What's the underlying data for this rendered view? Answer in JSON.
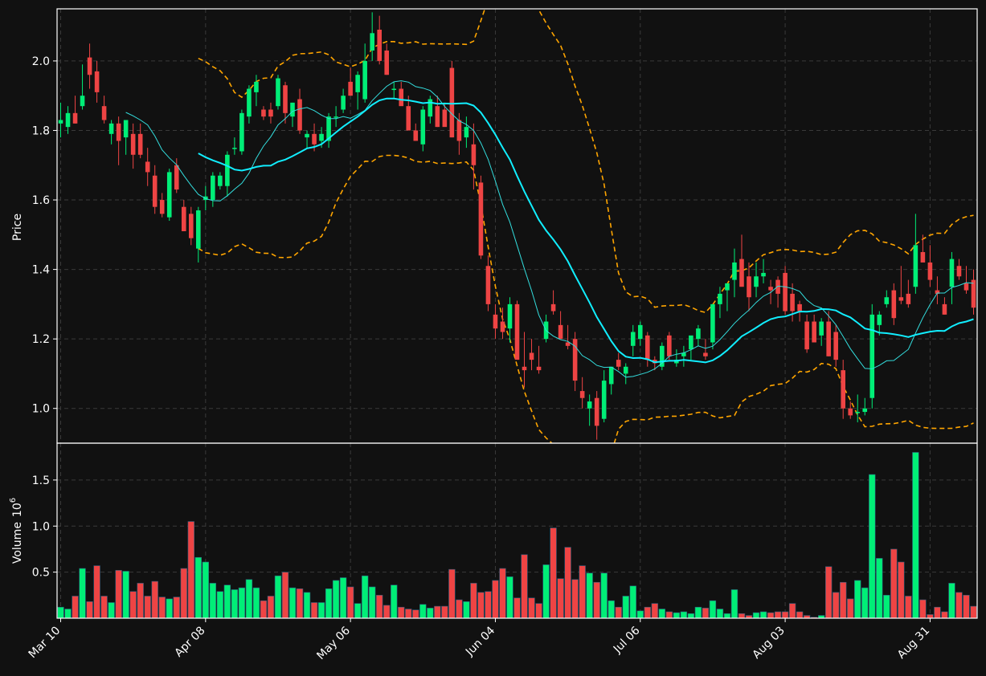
{
  "chart_data": {
    "type": "candlestick",
    "theme": {
      "background": "#111111",
      "up_color": "#00ee77",
      "down_color": "#ee4444",
      "sma_fast_color": "#33dddd",
      "sma_slow_color": "#11eeff",
      "band_color": "#ffa500",
      "grid": true
    },
    "price_axis": {
      "label": "Price",
      "ylim": [
        0.9,
        2.15
      ],
      "ticks": [
        "1.0",
        "1.2",
        "1.4",
        "1.6",
        "1.8",
        "2.0"
      ]
    },
    "volume_axis": {
      "label": "Volume",
      "exponent": "10",
      "exponent_power": "6",
      "ylim": [
        0,
        1.9
      ],
      "ticks": [
        "0.5",
        "1.0",
        "1.5"
      ]
    },
    "x_axis": {
      "ticks": [
        {
          "label": "Mar 10",
          "index": 0
        },
        {
          "label": "Apr 08",
          "index": 20
        },
        {
          "label": "May 06",
          "index": 40
        },
        {
          "label": "Jun 04",
          "index": 60
        },
        {
          "label": "Jul 06",
          "index": 80
        },
        {
          "label": "Aug 03",
          "index": 100
        },
        {
          "label": "Aug 31",
          "index": 120
        }
      ]
    },
    "candles": [
      [
        1.82,
        1.88,
        1.78,
        1.83,
        0.12
      ],
      [
        1.81,
        1.87,
        1.79,
        1.85,
        0.1
      ],
      [
        1.85,
        1.9,
        1.82,
        1.82,
        0.24
      ],
      [
        1.87,
        1.99,
        1.86,
        1.9,
        0.54
      ],
      [
        2.01,
        2.05,
        1.92,
        1.96,
        0.18
      ],
      [
        1.97,
        2.0,
        1.88,
        1.91,
        0.57
      ],
      [
        1.87,
        1.9,
        1.82,
        1.83,
        0.24
      ],
      [
        1.79,
        1.83,
        1.76,
        1.82,
        0.17
      ],
      [
        1.82,
        1.84,
        1.7,
        1.77,
        0.52
      ],
      [
        1.78,
        1.83,
        1.73,
        1.83,
        0.51
      ],
      [
        1.79,
        1.82,
        1.69,
        1.73,
        0.29
      ],
      [
        1.79,
        1.82,
        1.72,
        1.73,
        0.38
      ],
      [
        1.71,
        1.75,
        1.64,
        1.68,
        0.24
      ],
      [
        1.67,
        1.7,
        1.56,
        1.58,
        0.4
      ],
      [
        1.6,
        1.62,
        1.55,
        1.56,
        0.23
      ],
      [
        1.55,
        1.69,
        1.54,
        1.68,
        0.21
      ],
      [
        1.7,
        1.72,
        1.62,
        1.63,
        0.23
      ],
      [
        1.58,
        1.6,
        1.51,
        1.51,
        0.54
      ],
      [
        1.56,
        1.58,
        1.47,
        1.49,
        1.05
      ],
      [
        1.46,
        1.58,
        1.42,
        1.57,
        0.66
      ],
      [
        1.6,
        1.64,
        1.57,
        1.61,
        0.61
      ],
      [
        1.6,
        1.68,
        1.58,
        1.67,
        0.38
      ],
      [
        1.64,
        1.68,
        1.63,
        1.67,
        0.29
      ],
      [
        1.64,
        1.74,
        1.61,
        1.73,
        0.36
      ],
      [
        1.75,
        1.78,
        1.73,
        1.75,
        0.31
      ],
      [
        1.74,
        1.86,
        1.73,
        1.85,
        0.33
      ],
      [
        1.84,
        1.93,
        1.82,
        1.92,
        0.42
      ],
      [
        1.91,
        1.96,
        1.87,
        1.94,
        0.33
      ],
      [
        1.86,
        1.87,
        1.83,
        1.84,
        0.19
      ],
      [
        1.86,
        1.88,
        1.82,
        1.84,
        0.24
      ],
      [
        1.87,
        1.96,
        1.86,
        1.95,
        0.46
      ],
      [
        1.93,
        1.94,
        1.82,
        1.85,
        0.5
      ],
      [
        1.84,
        1.88,
        1.81,
        1.88,
        0.33
      ],
      [
        1.89,
        1.92,
        1.79,
        1.8,
        0.32
      ],
      [
        1.78,
        1.8,
        1.75,
        1.79,
        0.28
      ],
      [
        1.79,
        1.82,
        1.74,
        1.76,
        0.17
      ],
      [
        1.77,
        1.81,
        1.75,
        1.79,
        0.17
      ],
      [
        1.77,
        1.85,
        1.75,
        1.84,
        0.32
      ],
      [
        1.84,
        1.87,
        1.81,
        1.84,
        0.41
      ],
      [
        1.86,
        1.92,
        1.85,
        1.9,
        0.44
      ],
      [
        1.94,
        1.98,
        1.9,
        1.9,
        0.34
      ],
      [
        1.91,
        1.97,
        1.86,
        1.96,
        0.16
      ],
      [
        1.89,
        2.05,
        1.88,
        2.0,
        0.46
      ],
      [
        2.03,
        2.14,
        2.0,
        2.08,
        0.34
      ],
      [
        2.09,
        2.13,
        1.99,
        2.0,
        0.25
      ],
      [
        2.03,
        2.05,
        1.96,
        1.96,
        0.14
      ],
      [
        1.92,
        1.94,
        1.89,
        1.92,
        0.36
      ],
      [
        1.92,
        1.94,
        1.88,
        1.87,
        0.12
      ],
      [
        1.87,
        1.9,
        1.83,
        1.8,
        0.1
      ],
      [
        1.8,
        1.82,
        1.77,
        1.77,
        0.09
      ],
      [
        1.76,
        1.87,
        1.74,
        1.86,
        0.15
      ],
      [
        1.84,
        1.9,
        1.82,
        1.89,
        0.11
      ],
      [
        1.87,
        1.9,
        1.81,
        1.81,
        0.13
      ],
      [
        1.86,
        1.88,
        1.84,
        1.81,
        0.13
      ],
      [
        1.98,
        2.0,
        1.78,
        1.78,
        0.53
      ],
      [
        1.83,
        1.85,
        1.73,
        1.77,
        0.2
      ],
      [
        1.78,
        1.84,
        1.75,
        1.81,
        0.18
      ],
      [
        1.76,
        1.82,
        1.63,
        1.7,
        0.38
      ],
      [
        1.65,
        1.67,
        1.43,
        1.44,
        0.28
      ],
      [
        1.41,
        1.44,
        1.28,
        1.3,
        0.29
      ],
      [
        1.27,
        1.3,
        1.2,
        1.23,
        0.41
      ],
      [
        1.25,
        1.29,
        1.2,
        1.22,
        0.54
      ],
      [
        1.23,
        1.32,
        1.19,
        1.3,
        0.45
      ],
      [
        1.3,
        1.31,
        1.15,
        1.14,
        0.22
      ],
      [
        1.12,
        1.22,
        1.06,
        1.11,
        0.69
      ],
      [
        1.16,
        1.2,
        1.11,
        1.14,
        0.22
      ],
      [
        1.12,
        1.18,
        1.1,
        1.11,
        0.16
      ],
      [
        1.2,
        1.27,
        1.19,
        1.25,
        0.58
      ],
      [
        1.3,
        1.34,
        1.27,
        1.28,
        0.98
      ],
      [
        1.24,
        1.28,
        1.21,
        1.2,
        0.43
      ],
      [
        1.19,
        1.24,
        1.17,
        1.18,
        0.77
      ],
      [
        1.2,
        1.22,
        1.05,
        1.08,
        0.42
      ],
      [
        1.05,
        1.09,
        1.0,
        1.03,
        0.57
      ],
      [
        1.0,
        1.04,
        0.95,
        1.02,
        0.49
      ],
      [
        1.03,
        1.05,
        0.91,
        0.95,
        0.39
      ],
      [
        0.97,
        1.11,
        0.96,
        1.08,
        0.49
      ],
      [
        1.07,
        1.11,
        1.04,
        1.12,
        0.19
      ],
      [
        1.14,
        1.16,
        1.11,
        1.12,
        0.12
      ],
      [
        1.1,
        1.13,
        1.07,
        1.12,
        0.24
      ],
      [
        1.18,
        1.24,
        1.15,
        1.22,
        0.35
      ],
      [
        1.2,
        1.25,
        1.18,
        1.24,
        0.08
      ],
      [
        1.21,
        1.22,
        1.12,
        1.14,
        0.12
      ],
      [
        1.14,
        1.15,
        1.11,
        1.13,
        0.16
      ],
      [
        1.12,
        1.19,
        1.11,
        1.18,
        0.1
      ],
      [
        1.21,
        1.22,
        1.14,
        1.15,
        0.07
      ],
      [
        1.13,
        1.17,
        1.12,
        1.14,
        0.06
      ],
      [
        1.15,
        1.18,
        1.12,
        1.16,
        0.07
      ],
      [
        1.17,
        1.2,
        1.14,
        1.21,
        0.05
      ],
      [
        1.2,
        1.24,
        1.18,
        1.23,
        0.12
      ],
      [
        1.16,
        1.2,
        1.14,
        1.15,
        0.11
      ],
      [
        1.19,
        1.3,
        1.17,
        1.3,
        0.19
      ],
      [
        1.3,
        1.35,
        1.26,
        1.33,
        0.1
      ],
      [
        1.34,
        1.36,
        1.28,
        1.36,
        0.05
      ],
      [
        1.37,
        1.46,
        1.32,
        1.42,
        0.31
      ],
      [
        1.43,
        1.5,
        1.38,
        1.35,
        0.05
      ],
      [
        1.38,
        1.42,
        1.28,
        1.32,
        0.03
      ],
      [
        1.35,
        1.42,
        1.32,
        1.38,
        0.06
      ],
      [
        1.38,
        1.43,
        1.36,
        1.39,
        0.07
      ],
      [
        1.35,
        1.37,
        1.3,
        1.34,
        0.06
      ],
      [
        1.37,
        1.38,
        1.29,
        1.33,
        0.07
      ],
      [
        1.39,
        1.41,
        1.27,
        1.28,
        0.07
      ],
      [
        1.33,
        1.36,
        1.25,
        1.28,
        0.16
      ],
      [
        1.3,
        1.31,
        1.25,
        1.28,
        0.07
      ],
      [
        1.25,
        1.27,
        1.16,
        1.17,
        0.03
      ],
      [
        1.25,
        1.27,
        1.21,
        1.19,
        0.01
      ],
      [
        1.21,
        1.26,
        1.18,
        1.25,
        0.03
      ],
      [
        1.25,
        1.28,
        1.15,
        1.15,
        0.56
      ],
      [
        1.22,
        1.24,
        1.12,
        1.14,
        0.28
      ],
      [
        1.11,
        1.14,
        0.97,
        1.0,
        0.39
      ],
      [
        1.0,
        1.02,
        0.97,
        0.98,
        0.21
      ],
      [
        0.99,
        1.04,
        0.96,
        0.99,
        0.41
      ],
      [
        0.99,
        1.03,
        0.98,
        1.0,
        0.33
      ],
      [
        1.03,
        1.3,
        1.0,
        1.27,
        1.56
      ],
      [
        1.24,
        1.28,
        1.21,
        1.27,
        0.65
      ],
      [
        1.3,
        1.34,
        1.29,
        1.32,
        0.25
      ],
      [
        1.34,
        1.36,
        1.24,
        1.26,
        0.75
      ],
      [
        1.32,
        1.41,
        1.3,
        1.31,
        0.61
      ],
      [
        1.33,
        1.37,
        1.29,
        1.3,
        0.24
      ],
      [
        1.35,
        1.56,
        1.33,
        1.47,
        1.8
      ],
      [
        1.45,
        1.5,
        1.43,
        1.42,
        0.2
      ],
      [
        1.42,
        1.47,
        1.35,
        1.37,
        0.04
      ],
      [
        1.34,
        1.38,
        1.3,
        1.33,
        0.12
      ],
      [
        1.3,
        1.32,
        1.27,
        1.27,
        0.07
      ],
      [
        1.35,
        1.45,
        1.3,
        1.43,
        0.38
      ],
      [
        1.41,
        1.43,
        1.37,
        1.38,
        0.28
      ],
      [
        1.36,
        1.41,
        1.33,
        1.34,
        0.25
      ],
      [
        1.37,
        1.4,
        1.27,
        1.29,
        0.13
      ]
    ],
    "sma_fast": {
      "window": 10
    },
    "sma_slow": {
      "window": 20
    },
    "bollinger_bands": {
      "window": 20,
      "std_dev": 2,
      "style": "dashed"
    }
  }
}
